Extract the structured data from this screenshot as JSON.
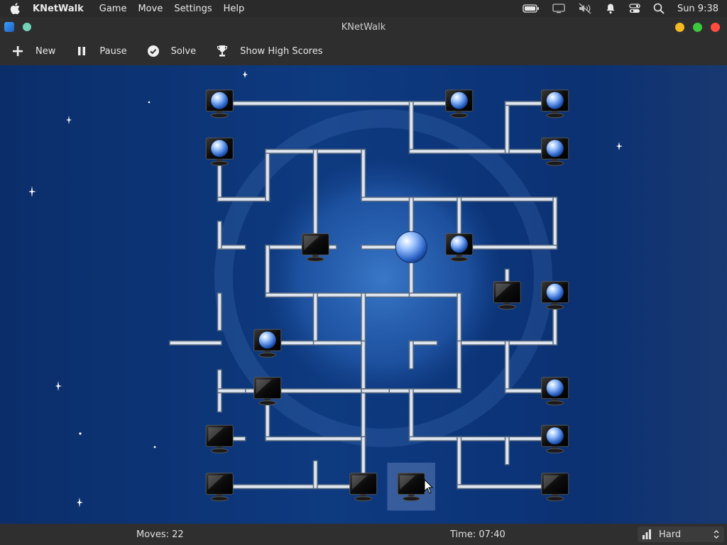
{
  "menubar": {
    "app_name": "KNetWalk",
    "items": [
      "Game",
      "Move",
      "Settings",
      "Help"
    ],
    "clock": "Sun 9:38"
  },
  "window": {
    "title": "KNetWalk"
  },
  "toolbar": {
    "new_label": "New",
    "pause_label": "Pause",
    "solve_label": "Solve",
    "highscores_label": "Show High Scores"
  },
  "status": {
    "moves": "Moves: 22",
    "time": "Time: 07:40",
    "difficulty": "Hard"
  },
  "board": {
    "columns": 9,
    "rows": 9,
    "server": {
      "col": 5,
      "row": 3
    },
    "selected_cell": {
      "col": 5,
      "row": 8
    },
    "terminals": [
      {
        "col": 1,
        "row": 0,
        "lit": true
      },
      {
        "col": 6,
        "row": 0,
        "lit": true
      },
      {
        "col": 8,
        "row": 0,
        "lit": true
      },
      {
        "col": 1,
        "row": 1,
        "lit": true
      },
      {
        "col": 8,
        "row": 1,
        "lit": true
      },
      {
        "col": 3,
        "row": 3,
        "lit": false
      },
      {
        "col": 6,
        "row": 3,
        "lit": true
      },
      {
        "col": 7,
        "row": 4,
        "lit": false
      },
      {
        "col": 8,
        "row": 4,
        "lit": true
      },
      {
        "col": 2,
        "row": 5,
        "lit": true
      },
      {
        "col": 2,
        "row": 6,
        "lit": false
      },
      {
        "col": 8,
        "row": 6,
        "lit": true
      },
      {
        "col": 1,
        "row": 7,
        "lit": false
      },
      {
        "col": 8,
        "row": 7,
        "lit": true
      },
      {
        "col": 1,
        "row": 8,
        "lit": false
      },
      {
        "col": 4,
        "row": 8,
        "lit": false
      },
      {
        "col": 5,
        "row": 8,
        "lit": false
      },
      {
        "col": 8,
        "row": 8,
        "lit": false
      }
    ]
  }
}
